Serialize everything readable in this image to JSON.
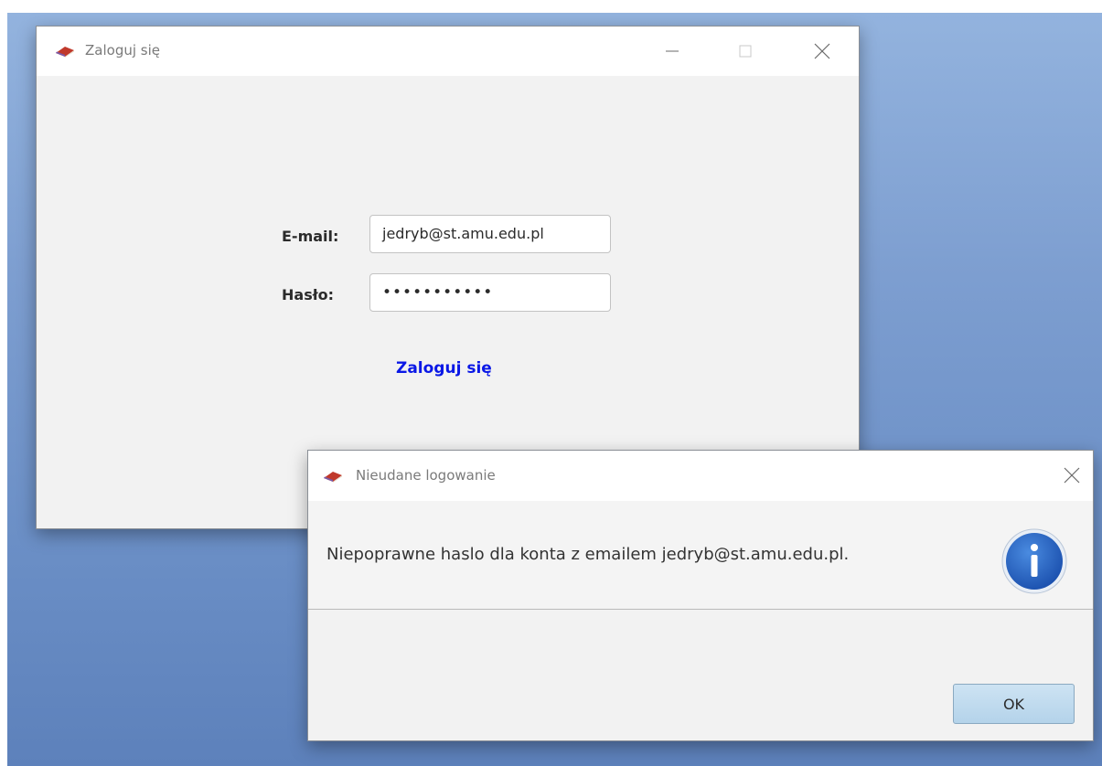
{
  "login_window": {
    "title": "Zaloguj się",
    "email_label": "E-mail:",
    "email_value": "jedryb@st.amu.edu.pl",
    "password_label": "Hasło:",
    "password_value": "•••••••••••",
    "login_link": "Zaloguj się"
  },
  "dialog": {
    "title": "Nieudane logowanie",
    "message": "Niepoprawne haslo dla konta z emailem jedryb@st.amu.edu.pl.",
    "ok_label": "OK",
    "icon": "info-icon"
  },
  "colors": {
    "link": "#0a18e6",
    "info_icon": "#1f5fc4",
    "desktop_gradient_top": "#93b3de",
    "desktop_gradient_bottom": "#5d81bb"
  }
}
